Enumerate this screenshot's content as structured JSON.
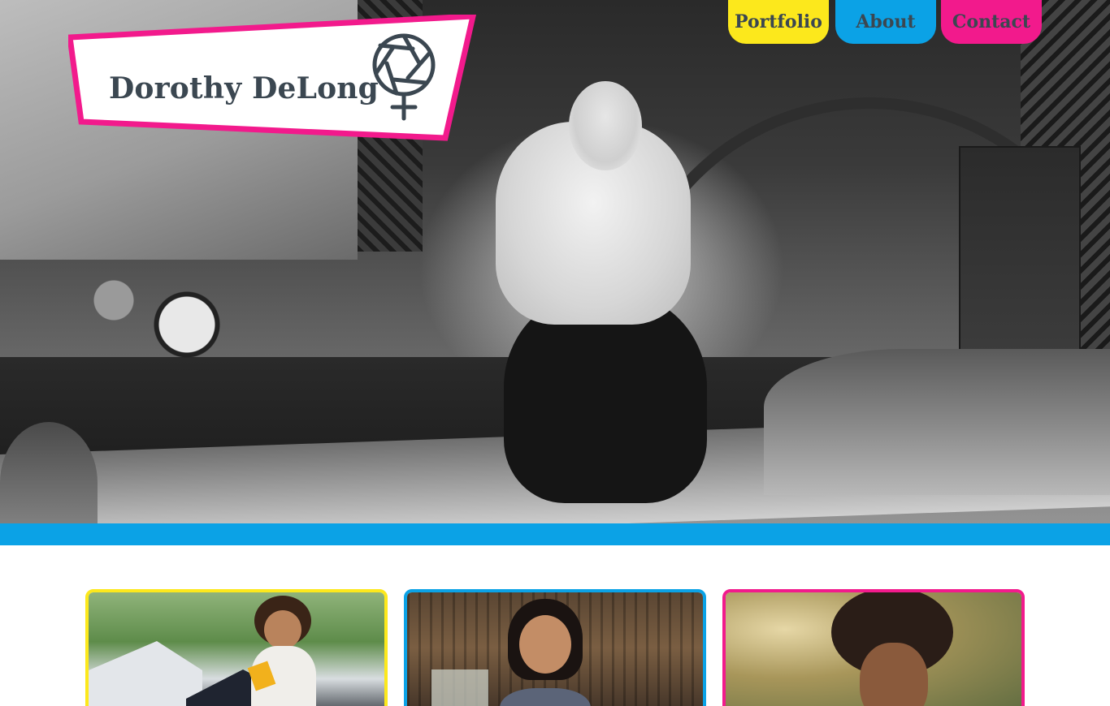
{
  "site": {
    "name": "Dorothy DeLong",
    "logo_icon": "venus-aperture-icon"
  },
  "nav": {
    "items": [
      {
        "label": "Portfolio",
        "color": "#fce81c"
      },
      {
        "label": "About",
        "color": "#0ba2e6"
      },
      {
        "label": "Contact",
        "color": "#f21a8c"
      }
    ]
  },
  "colors": {
    "accent_yellow": "#fce81c",
    "accent_blue": "#0ba2e6",
    "accent_pink": "#f21a8c",
    "text_dark": "#3b4751"
  }
}
